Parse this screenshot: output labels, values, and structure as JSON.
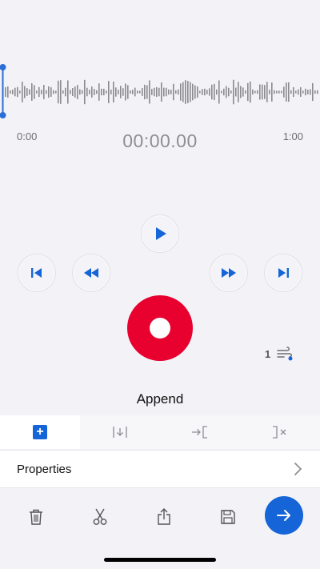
{
  "waveform": {
    "time_start": "0:00",
    "time_end": "1:00",
    "current_time": "00:00.00"
  },
  "playback_speed": {
    "value": "1"
  },
  "mode": {
    "title": "Append",
    "tabs": [
      {
        "icon": "append-icon",
        "active": true
      },
      {
        "icon": "insert-icon",
        "active": false
      },
      {
        "icon": "overwrite-icon",
        "active": false
      },
      {
        "icon": "trim-icon",
        "active": false
      }
    ]
  },
  "properties": {
    "label": "Properties"
  },
  "colors": {
    "accent_blue": "#1565d8",
    "record_red": "#e8002f",
    "playhead_blue": "#2a6fd6",
    "wave_gray": "#8a8a8f"
  }
}
